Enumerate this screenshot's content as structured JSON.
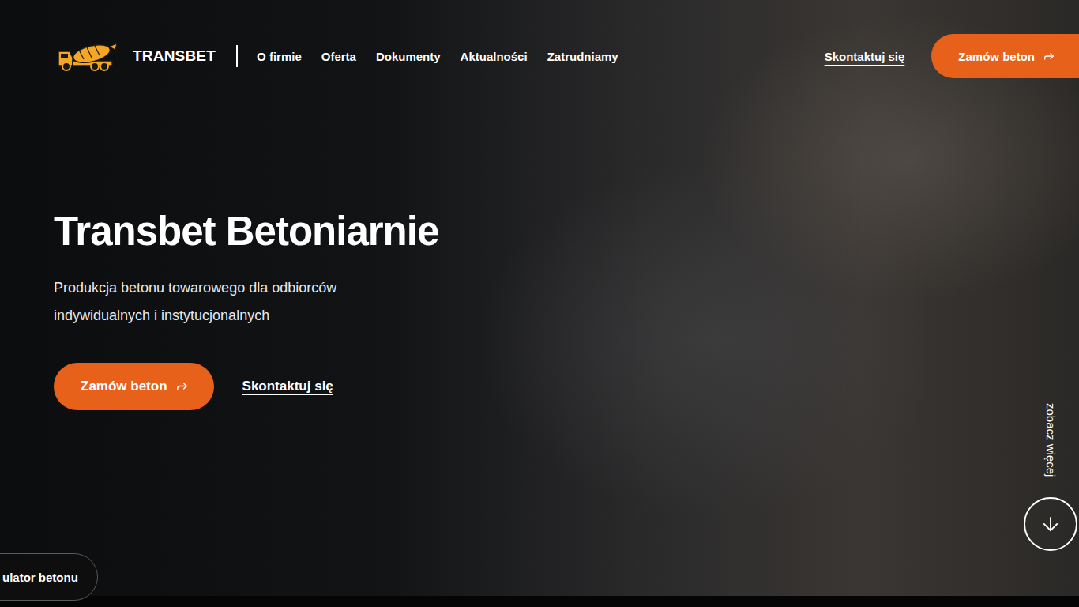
{
  "header": {
    "logo": {
      "name": "TRANSBET"
    },
    "nav": [
      {
        "label": "O firmie"
      },
      {
        "label": "Oferta"
      },
      {
        "label": "Dokumenty"
      },
      {
        "label": "Aktualności"
      },
      {
        "label": "Zatrudniamy"
      }
    ],
    "contact_link": "Skontaktuj się",
    "order_button": "Zamów beton"
  },
  "hero": {
    "title": "Transbet Betoniarnie",
    "subtitle": "Produkcja betonu towarowego dla odbiorców indywidualnych i instytucjonalnych",
    "primary_button": "Zamów beton",
    "secondary_link": "Skontaktuj się"
  },
  "scroll_hint": {
    "label": "zobacz więcej"
  },
  "calculator_tab": {
    "label": "ulator betonu"
  }
}
